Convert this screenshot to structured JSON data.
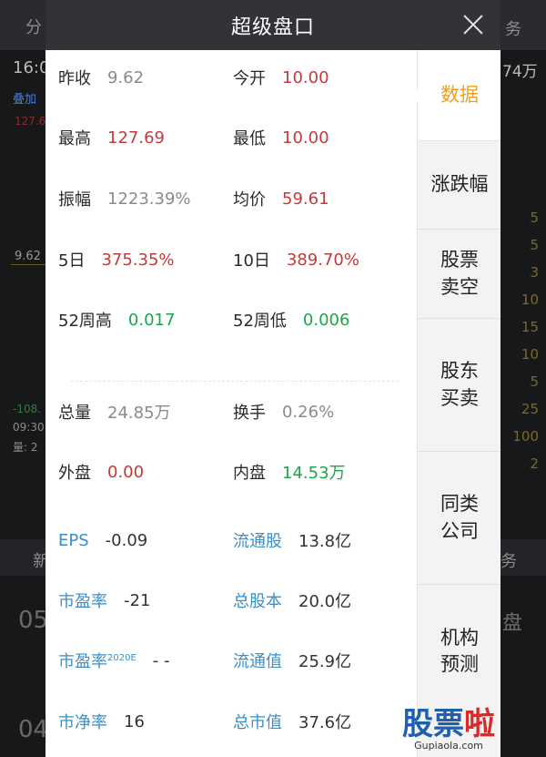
{
  "background": {
    "top_left": "分",
    "top_right": "务",
    "time": "16:0",
    "badge": "叠加",
    "price1": "127.6",
    "price2": "9.62",
    "right_top": "74万",
    "neg": "-108.",
    "t0930": "09:30",
    "vol": "量: 2",
    "tab_left": "新",
    "tab_right": "务",
    "row05": "05",
    "row04": "04",
    "disk": "盘",
    "right_col": [
      "5",
      "5",
      "3",
      "10",
      "15",
      "10",
      "5",
      "25",
      "100",
      "2"
    ]
  },
  "modal": {
    "title": "超级盘口",
    "rows": [
      {
        "l1": "昨收",
        "v1": "9.62",
        "l2": "今开",
        "v2": "10.00"
      },
      {
        "l1": "最高",
        "v1": "127.69",
        "l2": "最低",
        "v2": "10.00"
      },
      {
        "l1": "振幅",
        "v1": "1223.39%",
        "l2": "均价",
        "v2": "59.61"
      },
      {
        "l1": "5日",
        "v1": "375.35%",
        "l2": "10日",
        "v2": "389.70%"
      },
      {
        "l1": "52周高",
        "v1": "0.017",
        "l2": "52周低",
        "v2": "0.006"
      },
      {
        "l1": "总量",
        "v1": "24.85万",
        "l2": "换手",
        "v2": "0.26%"
      },
      {
        "l1": "外盘",
        "v1": "0.00",
        "l2": "内盘",
        "v2": "14.53万"
      },
      {
        "l1": "EPS",
        "v1": "-0.09",
        "l2": "流通股",
        "v2": "13.8亿"
      },
      {
        "l1": "市盈率",
        "v1": "-21",
        "l2": "总股本",
        "v2": "20.0亿"
      },
      {
        "l1": "市盈率",
        "sup": "2020E",
        "v1": "- -",
        "l2": "流通值",
        "v2": "25.9亿"
      },
      {
        "l1": "市净率",
        "v1": "16",
        "l2": "总市值",
        "v2": "37.6亿"
      }
    ],
    "side": [
      {
        "label": "数据"
      },
      {
        "label": "涨跌幅"
      },
      {
        "label": "股票\n卖空"
      },
      {
        "label": "股东\n买卖"
      },
      {
        "label": "同类\n公司"
      },
      {
        "label": "机构\n预测"
      }
    ]
  },
  "watermark": {
    "part1": "股票",
    "part2": "啦",
    "url": "Gupiaola.com"
  },
  "colors": {
    "red": "#c43a3a",
    "green": "#1aa64a",
    "blue": "#3a8fc8",
    "orange": "#f0a020"
  }
}
